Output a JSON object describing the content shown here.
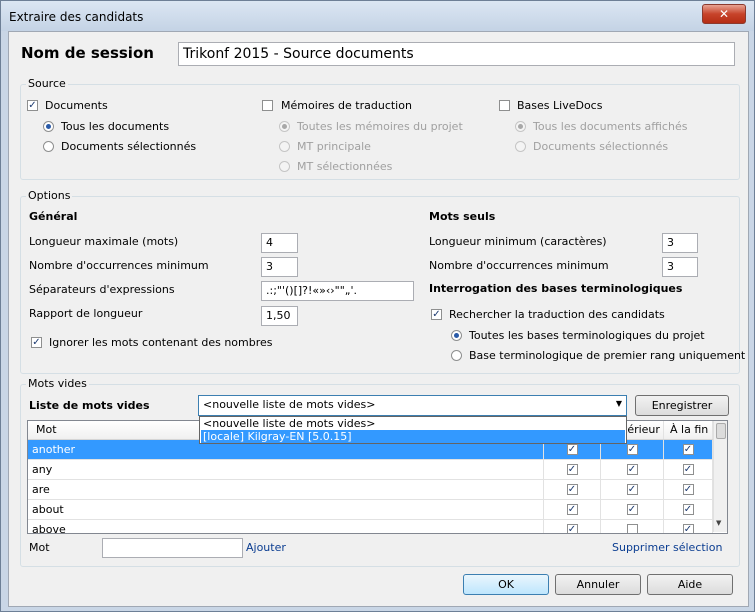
{
  "window": {
    "title": "Extraire des candidats",
    "close_glyph": "✕"
  },
  "session": {
    "label": "Nom de session",
    "value": "Trikonf 2015 - Source documents"
  },
  "source": {
    "legend": "Source",
    "documents": {
      "label": "Documents",
      "checked": true,
      "all": "Tous les documents",
      "selected": "Documents sélectionnés"
    },
    "memories": {
      "label": "Mémoires de traduction",
      "checked": false,
      "all": "Toutes les mémoires du projet",
      "main": "MT principale",
      "selected": "MT sélectionnées"
    },
    "livedocs": {
      "label": "Bases LiveDocs",
      "checked": false,
      "all": "Tous les documents affichés",
      "selected": "Documents sélectionnés"
    }
  },
  "options": {
    "legend": "Options",
    "general": {
      "heading": "Général",
      "max_length_label": "Longueur maximale (mots)",
      "max_length": "4",
      "min_occ_label": "Nombre d'occurrences minimum",
      "min_occ": "3",
      "separators_label": "Séparateurs d'expressions",
      "separators": ".:;\"'()[]?!«»‹›\"\"„'.",
      "ratio_label": "Rapport de longueur",
      "ratio": "1,50",
      "ignore_numbers_label": "Ignorer les mots contenant des nombres",
      "ignore_numbers": true
    },
    "single": {
      "heading": "Mots seuls",
      "min_length_label": "Longueur minimum (caractères)",
      "min_length": "3",
      "min_occ_label": "Nombre d'occurrences minimum",
      "min_occ": "3"
    },
    "termbase": {
      "heading": "Interrogation des bases terminologiques",
      "search_label": "Rechercher la traduction des candidats",
      "search": true,
      "all_label": "Toutes les bases terminologiques du projet",
      "primary_label": "Base terminologique de premier rang uniquement"
    }
  },
  "stopwords": {
    "legend": "Mots vides",
    "list_label": "Liste de mots vides",
    "selected_list": "<nouvelle liste de mots vides>",
    "dropdown_options": [
      "<nouvelle liste de mots vides>",
      "[locale] Kilgray-EN [5.0.15]"
    ],
    "save_button": "Enregistrer",
    "columns": [
      "Mot",
      "",
      "Postérieur",
      "À la fin"
    ],
    "column_visible": [
      "Mot",
      "térieur",
      "À la fin"
    ],
    "rows": [
      {
        "word": "another",
        "c1": true,
        "c2": true,
        "c3": true
      },
      {
        "word": "any",
        "c1": true,
        "c2": true,
        "c3": true
      },
      {
        "word": "are",
        "c1": true,
        "c2": true,
        "c3": true
      },
      {
        "word": "about",
        "c1": true,
        "c2": true,
        "c3": true
      },
      {
        "word": "above",
        "c1": true,
        "c2": false,
        "c3": true
      }
    ],
    "word_label": "Mot",
    "word_value": "",
    "add_link": "Ajouter",
    "remove_link": "Supprimer sélection"
  },
  "buttons": {
    "ok": "OK",
    "cancel": "Annuler",
    "help": "Aide"
  },
  "check_glyph": "✓"
}
